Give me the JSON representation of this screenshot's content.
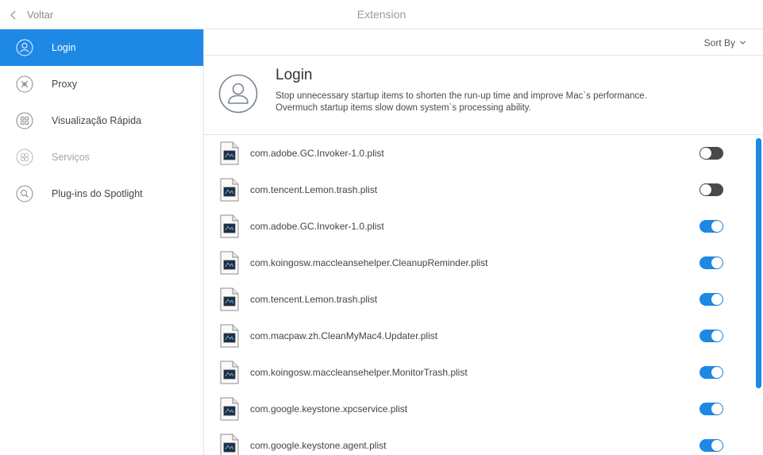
{
  "titlebar": {
    "back_label": "Voltar",
    "title": "Extension"
  },
  "sidebar": {
    "items": [
      {
        "label": "Login"
      },
      {
        "label": "Proxy"
      },
      {
        "label": "Visualização Rápida"
      },
      {
        "label": "Serviços"
      },
      {
        "label": "Plug-ins do Spotlight"
      }
    ]
  },
  "toolbar": {
    "sort_label": "Sort By"
  },
  "header": {
    "title": "Login",
    "description_line1": "Stop unnecessary startup items to shorten the run-up time and improve Mac`s performance.",
    "description_line2": "Overmuch startup items slow down system`s processing ability."
  },
  "items": [
    {
      "name": "com.adobe.GC.Invoker-1.0.plist",
      "enabled": false
    },
    {
      "name": "com.tencent.Lemon.trash.plist",
      "enabled": false
    },
    {
      "name": "com.adobe.GC.Invoker-1.0.plist",
      "enabled": true
    },
    {
      "name": "com.koingosw.maccleansehelper.CleanupReminder.plist",
      "enabled": true
    },
    {
      "name": "com.tencent.Lemon.trash.plist",
      "enabled": true
    },
    {
      "name": "com.macpaw.zh.CleanMyMac4.Updater.plist",
      "enabled": true
    },
    {
      "name": "com.koingosw.maccleansehelper.MonitorTrash.plist",
      "enabled": true
    },
    {
      "name": "com.google.keystone.xpcservice.plist",
      "enabled": true
    },
    {
      "name": "com.google.keystone.agent.plist",
      "enabled": true
    }
  ],
  "colors": {
    "accent": "#1e88e5",
    "toggle_off": "#4a4a4a"
  }
}
